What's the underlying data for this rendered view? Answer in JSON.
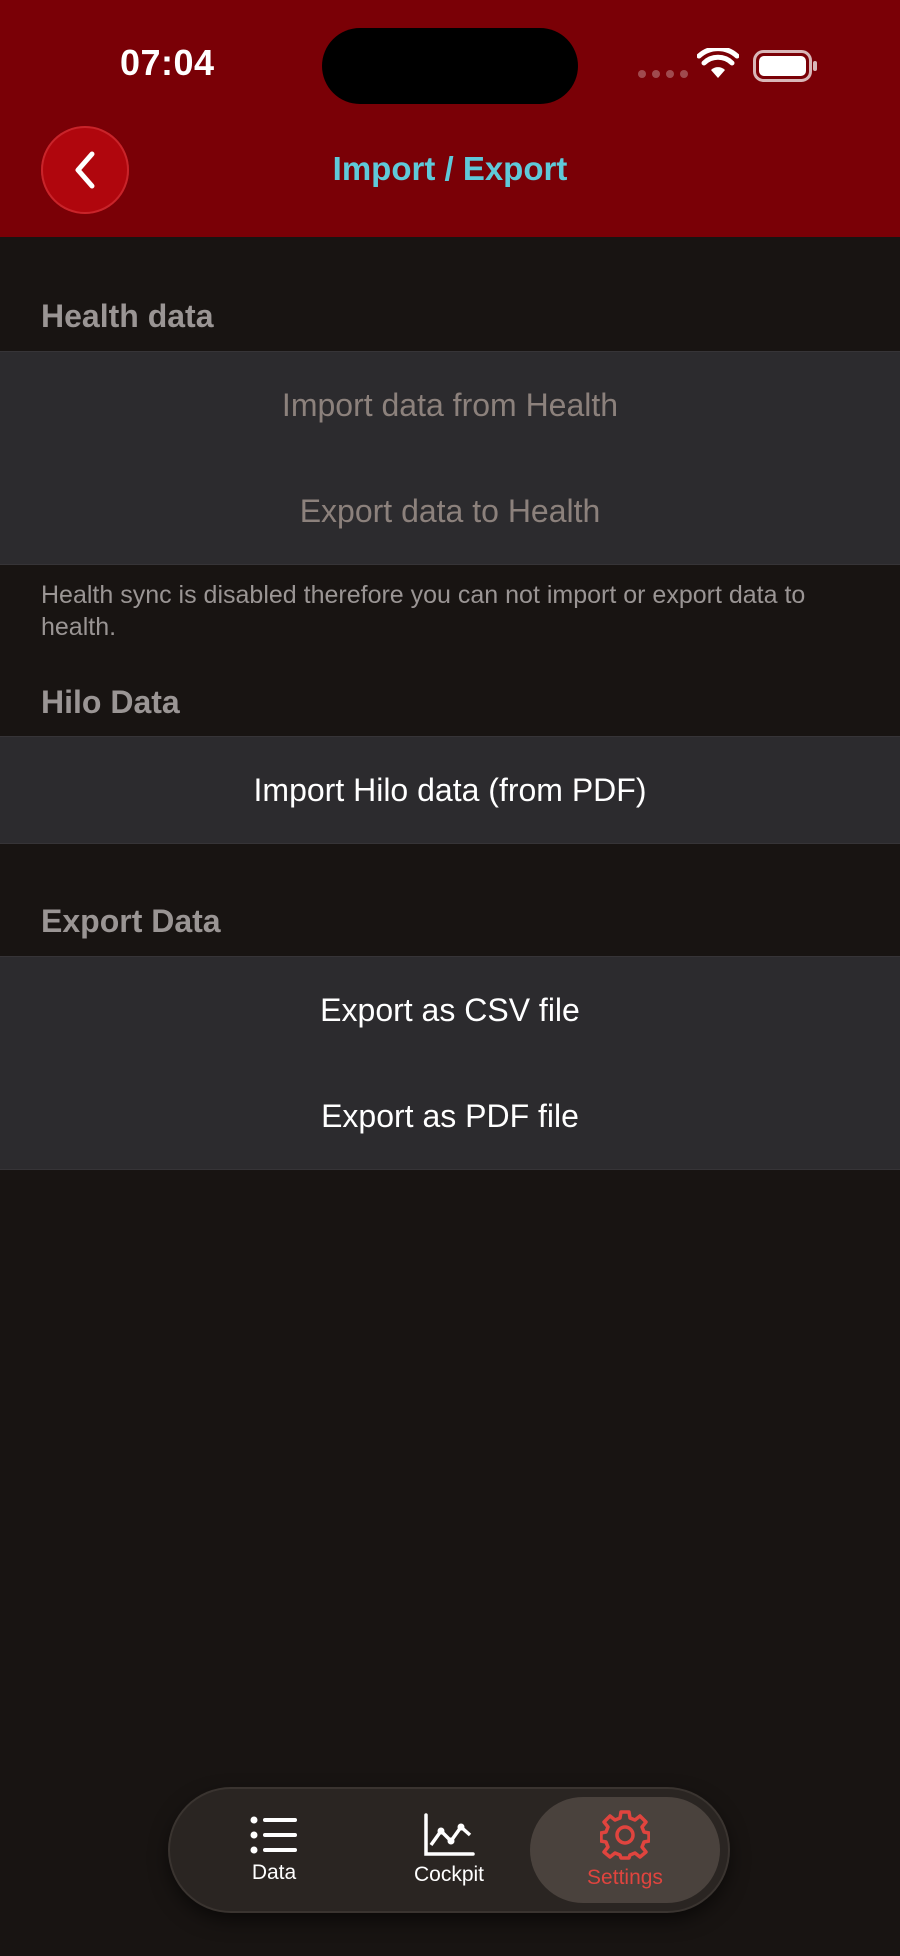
{
  "status_bar": {
    "time": "07:04"
  },
  "nav": {
    "title": "Import / Export",
    "back_icon": "chevron-left-icon"
  },
  "colors": {
    "header_bg": "#7a0006",
    "accent_title": "#5fc9d9",
    "back_button": "#b0060d",
    "settings_active": "#e0443e",
    "background": "#181412",
    "cell_bg": "#2c2b2e"
  },
  "sections": {
    "health": {
      "header": "Health data",
      "rows": [
        "Import data from Health",
        "Export data to Health"
      ],
      "footer": "Health sync is disabled therefore you can not import or export data to health."
    },
    "hilo": {
      "header": "Hilo Data",
      "rows": [
        "Import Hilo data (from PDF)"
      ]
    },
    "export": {
      "header": "Export Data",
      "rows": [
        "Export as CSV file",
        "Export as PDF file"
      ]
    }
  },
  "tabbar": {
    "tabs": [
      {
        "label": "Data",
        "icon": "list-icon"
      },
      {
        "label": "Cockpit",
        "icon": "chart-icon"
      },
      {
        "label": "Settings",
        "icon": "gear-icon",
        "active": true
      }
    ]
  }
}
